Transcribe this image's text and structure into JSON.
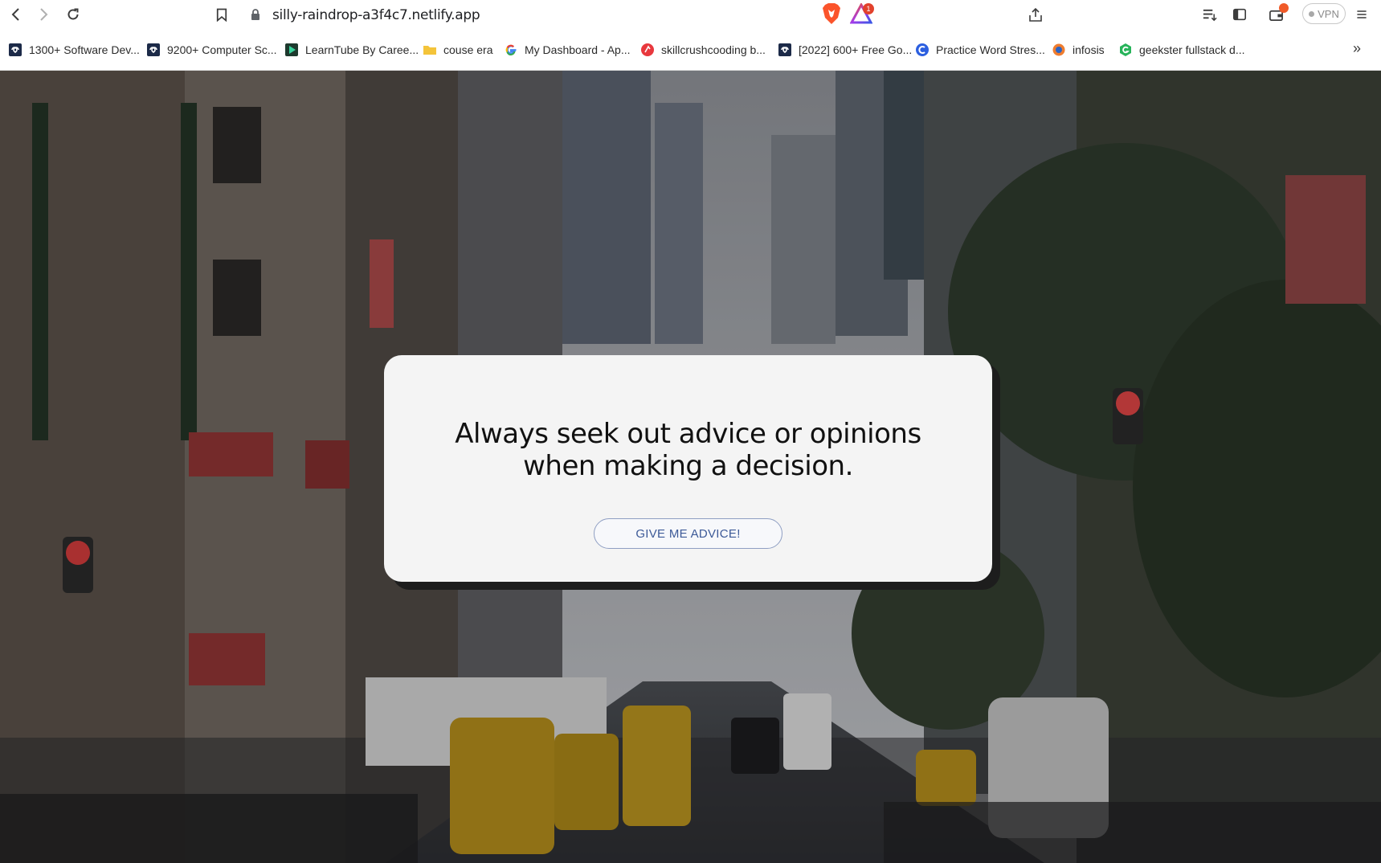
{
  "browser": {
    "url": "silly-raindrop-a3f4c7.netlify.app",
    "rewards_count": "1",
    "vpn_label": "VPN",
    "bookmarks_overflow": "»"
  },
  "bookmarks": [
    {
      "label": "1300+ Software Dev...",
      "icon": "gfg-icon"
    },
    {
      "label": "9200+ Computer Sc...",
      "icon": "gfg-icon"
    },
    {
      "label": "LearnTube By Caree...",
      "icon": "learntube-icon"
    },
    {
      "label": "couse era",
      "icon": "folder-icon"
    },
    {
      "label": "My Dashboard - Ap...",
      "icon": "google-icon"
    },
    {
      "label": "skillcrushcooding b...",
      "icon": "skillcrush-icon"
    },
    {
      "label": "[2022] 600+ Free Go...",
      "icon": "gfg-icon"
    },
    {
      "label": "Practice Word Stres...",
      "icon": "practice-icon"
    },
    {
      "label": "infosis",
      "icon": "infosys-icon"
    },
    {
      "label": "geekster fullstack d...",
      "icon": "geekster-icon"
    }
  ],
  "main": {
    "advice": "Always seek out advice or opinions when making a decision.",
    "button_label": "GIVE ME ADVICE!"
  }
}
